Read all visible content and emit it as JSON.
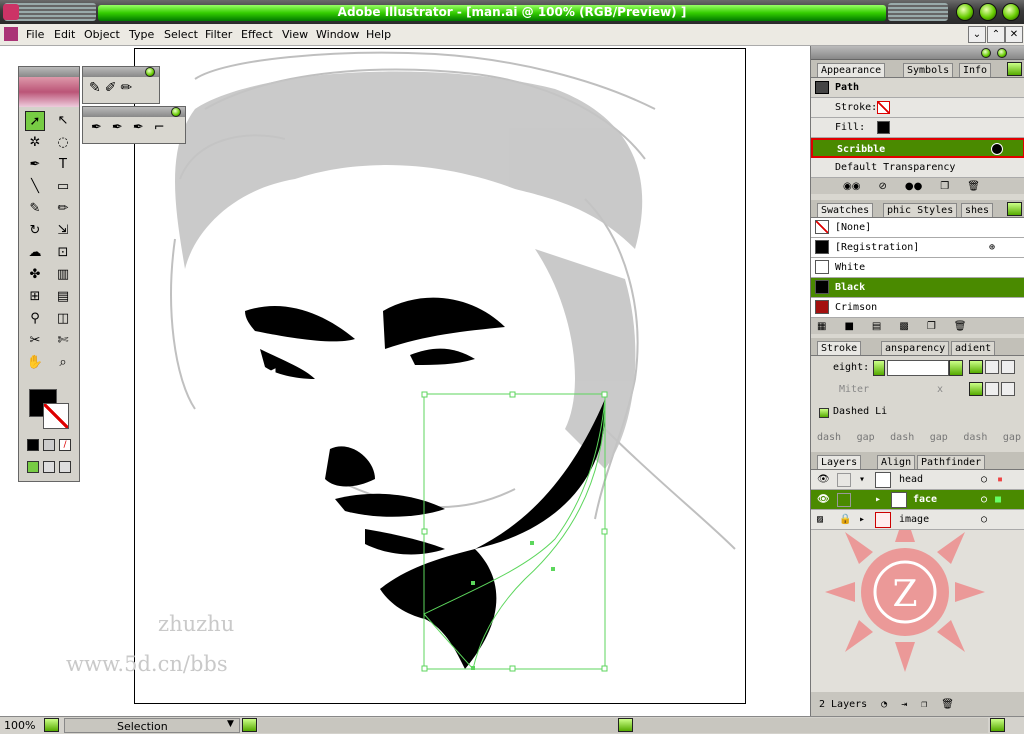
{
  "window": {
    "title": "Adobe Illustrator - [man.ai @ 100% (RGB/Preview) ]"
  },
  "menu": [
    "File",
    "Edit",
    "Object",
    "Type",
    "Select",
    "Filter",
    "Effect",
    "View",
    "Window",
    "Help"
  ],
  "appearance": {
    "tabs": [
      "Appearance",
      "Symbols",
      "Info"
    ],
    "object": "Path",
    "stroke_label": "Stroke:",
    "fill_label": "Fill:",
    "effect": "Scribble",
    "transparency": "Default Transparency"
  },
  "swatches": {
    "tabs": [
      "Swatches",
      "phic Styles",
      "shes"
    ],
    "items": [
      "[None]",
      "[Registration]",
      "White",
      "Black",
      "Crimson"
    ],
    "colors": [
      "#ffffff",
      "#000000",
      "#ffffff",
      "#000000",
      "#a3100f"
    ]
  },
  "stroke": {
    "tabs": [
      "Stroke",
      "ansparency",
      "adient"
    ],
    "weight_label": "eight:",
    "miter_label": "Miter",
    "miter_x": "x",
    "dashed_label": "Dashed Li",
    "dash_labels": [
      "dash",
      "gap",
      "dash",
      "gap",
      "dash",
      "gap"
    ]
  },
  "layers": {
    "tabs": [
      "Layers",
      "Align",
      "Pathfinder"
    ],
    "items": [
      "head",
      "face",
      "image"
    ],
    "count": "2 Layers"
  },
  "status": {
    "zoom": "100%",
    "mode": "Selection"
  },
  "watermark": {
    "line1": "zhuzhu",
    "line2": "www.5d.cn/bbs"
  },
  "colors": {
    "accent": "#4a8a00",
    "highlight": "#e00000"
  }
}
